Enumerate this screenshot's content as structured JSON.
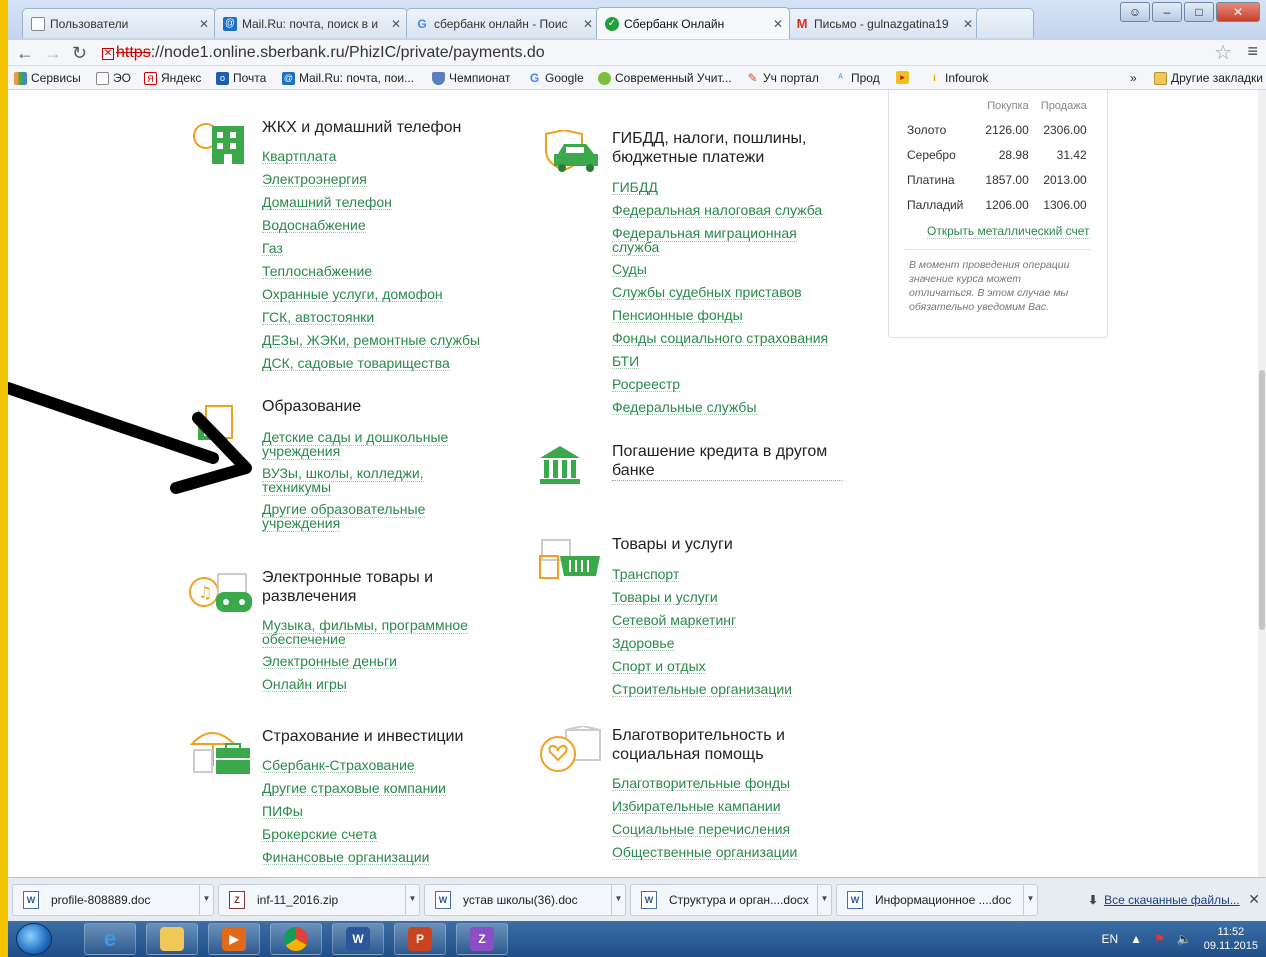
{
  "browser": {
    "tabs": [
      {
        "title": "Пользователи"
      },
      {
        "title": "Mail.Ru: почта, поиск в и"
      },
      {
        "title": "сбербанк онлайн - Поис"
      },
      {
        "title": "Сбербанк Онлайн",
        "active": true
      },
      {
        "title": "Письмо - gulnazgatina19"
      }
    ],
    "url_scheme": "https",
    "url_rest": "://node1.online.sberbank.ru/PhizIC/private/payments.do",
    "bookmarks": [
      "Сервисы",
      "ЭО",
      "Яндекс",
      "Почта",
      "Mail.Ru: почта, пои...",
      "Чемпионат",
      "Google",
      "Современный Учит...",
      "Уч портал",
      "Прод",
      "Infourok"
    ],
    "more_bookmarks": "»",
    "other_bookmarks": "Другие закладки"
  },
  "categories": [
    {
      "title": "ЖКХ и домашний телефон",
      "icon": "building-icon",
      "links": [
        "Квартплата",
        "Электроэнергия",
        "Домашний телефон",
        "Водоснабжение",
        "Газ",
        "Теплоснабжение",
        "Охранные услуги, домофон",
        "ГСК, автостоянки",
        "ДЕЗы, ЖЭКи, ремонтные службы",
        "ДСК, садовые товарищества"
      ]
    },
    {
      "title": "Образование",
      "icon": "ruler-triangle-icon",
      "links": [
        "Детские сады и дошкольные учреждения",
        "ВУЗы, школы, колледжи, техникумы",
        "Другие образовательные учреждения"
      ]
    },
    {
      "title": "Электронные товары и развлечения",
      "icon": "gamepad-icon",
      "links": [
        "Музыка, фильмы, программное обеспечение",
        "Электронные деньги",
        "Онлайн игры"
      ]
    },
    {
      "title": "Страхование и инвестиции",
      "icon": "umbrella-briefcase-icon",
      "links": [
        "Сбербанк-Страхование",
        "Другие страховые компании",
        "ПИФы",
        "Брокерские счета",
        "Финансовые организации"
      ]
    },
    {
      "title": "ГИБДД, налоги, пошлины, бюджетные платежи",
      "icon": "car-shield-icon",
      "links": [
        "ГИБДД",
        "Федеральная налоговая служба",
        "Федеральная миграционная служба",
        "Суды",
        "Службы судебных приставов",
        "Пенсионные фонды",
        "Фонды социального страхования",
        "БТИ",
        "Росреестр",
        "Федеральные службы"
      ]
    },
    {
      "title": "Погашение кредита в другом банке",
      "icon": "bank-icon",
      "links": []
    },
    {
      "title": "Товары и услуги",
      "icon": "basket-icon",
      "links": [
        "Транспорт",
        "Товары и услуги",
        "Сетевой маркетинг",
        "Здоровье",
        "Спорт и отдых",
        "Строительные организации"
      ]
    },
    {
      "title": "Благотворительность и социальная помощь",
      "icon": "heart-hand-icon",
      "links": [
        "Благотворительные фонды",
        "Избирательные кампании",
        "Социальные перечисления",
        "Общественные организации"
      ]
    }
  ],
  "rates": {
    "buy_header": "Покупка",
    "sell_header": "Продажа",
    "rows": [
      {
        "metal": "Золото",
        "buy": "2126.00",
        "sell": "2306.00"
      },
      {
        "metal": "Серебро",
        "buy": "28.98",
        "sell": "31.42"
      },
      {
        "metal": "Платина",
        "buy": "1857.00",
        "sell": "2013.00"
      },
      {
        "metal": "Палладий",
        "buy": "1206.00",
        "sell": "1306.00"
      }
    ],
    "account_link": "Открыть металлический счет",
    "note": "В момент проведения операции значение курса может отличаться. В этом случае мы обязательно уведомим Вас."
  },
  "downloads": {
    "files": [
      "profile-808889.doc",
      "inf-11_2016.zip",
      "устав школы(36).doc",
      "Структура и орган....docx",
      "Информационное ....doc"
    ],
    "all_files": "Все скачанные файлы..."
  },
  "taskbar": {
    "lang": "EN",
    "time": "11:52",
    "date": "09.11.2015"
  },
  "colors": {
    "link": "#2a8a4a",
    "frame": "#f5c400",
    "icon_green": "#3aa84b",
    "icon_orange": "#f0a020"
  }
}
